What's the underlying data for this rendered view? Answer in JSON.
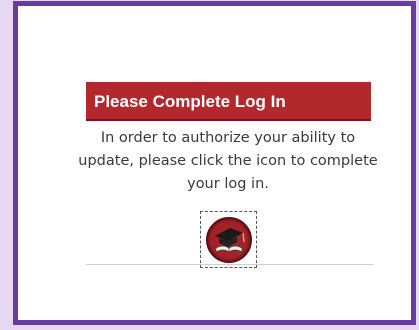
{
  "login_panel": {
    "title": "Please Complete Log In",
    "message": "In order to authorize your ability to update, please click the icon to complete your log in.",
    "login_icon": "graduation-cap-book-icon"
  },
  "colors": {
    "frame_border": "#6b3a9e",
    "outer_background": "#e6d8f2",
    "banner_background": "#b3282d",
    "icon_circle": "#8a1a1f"
  }
}
